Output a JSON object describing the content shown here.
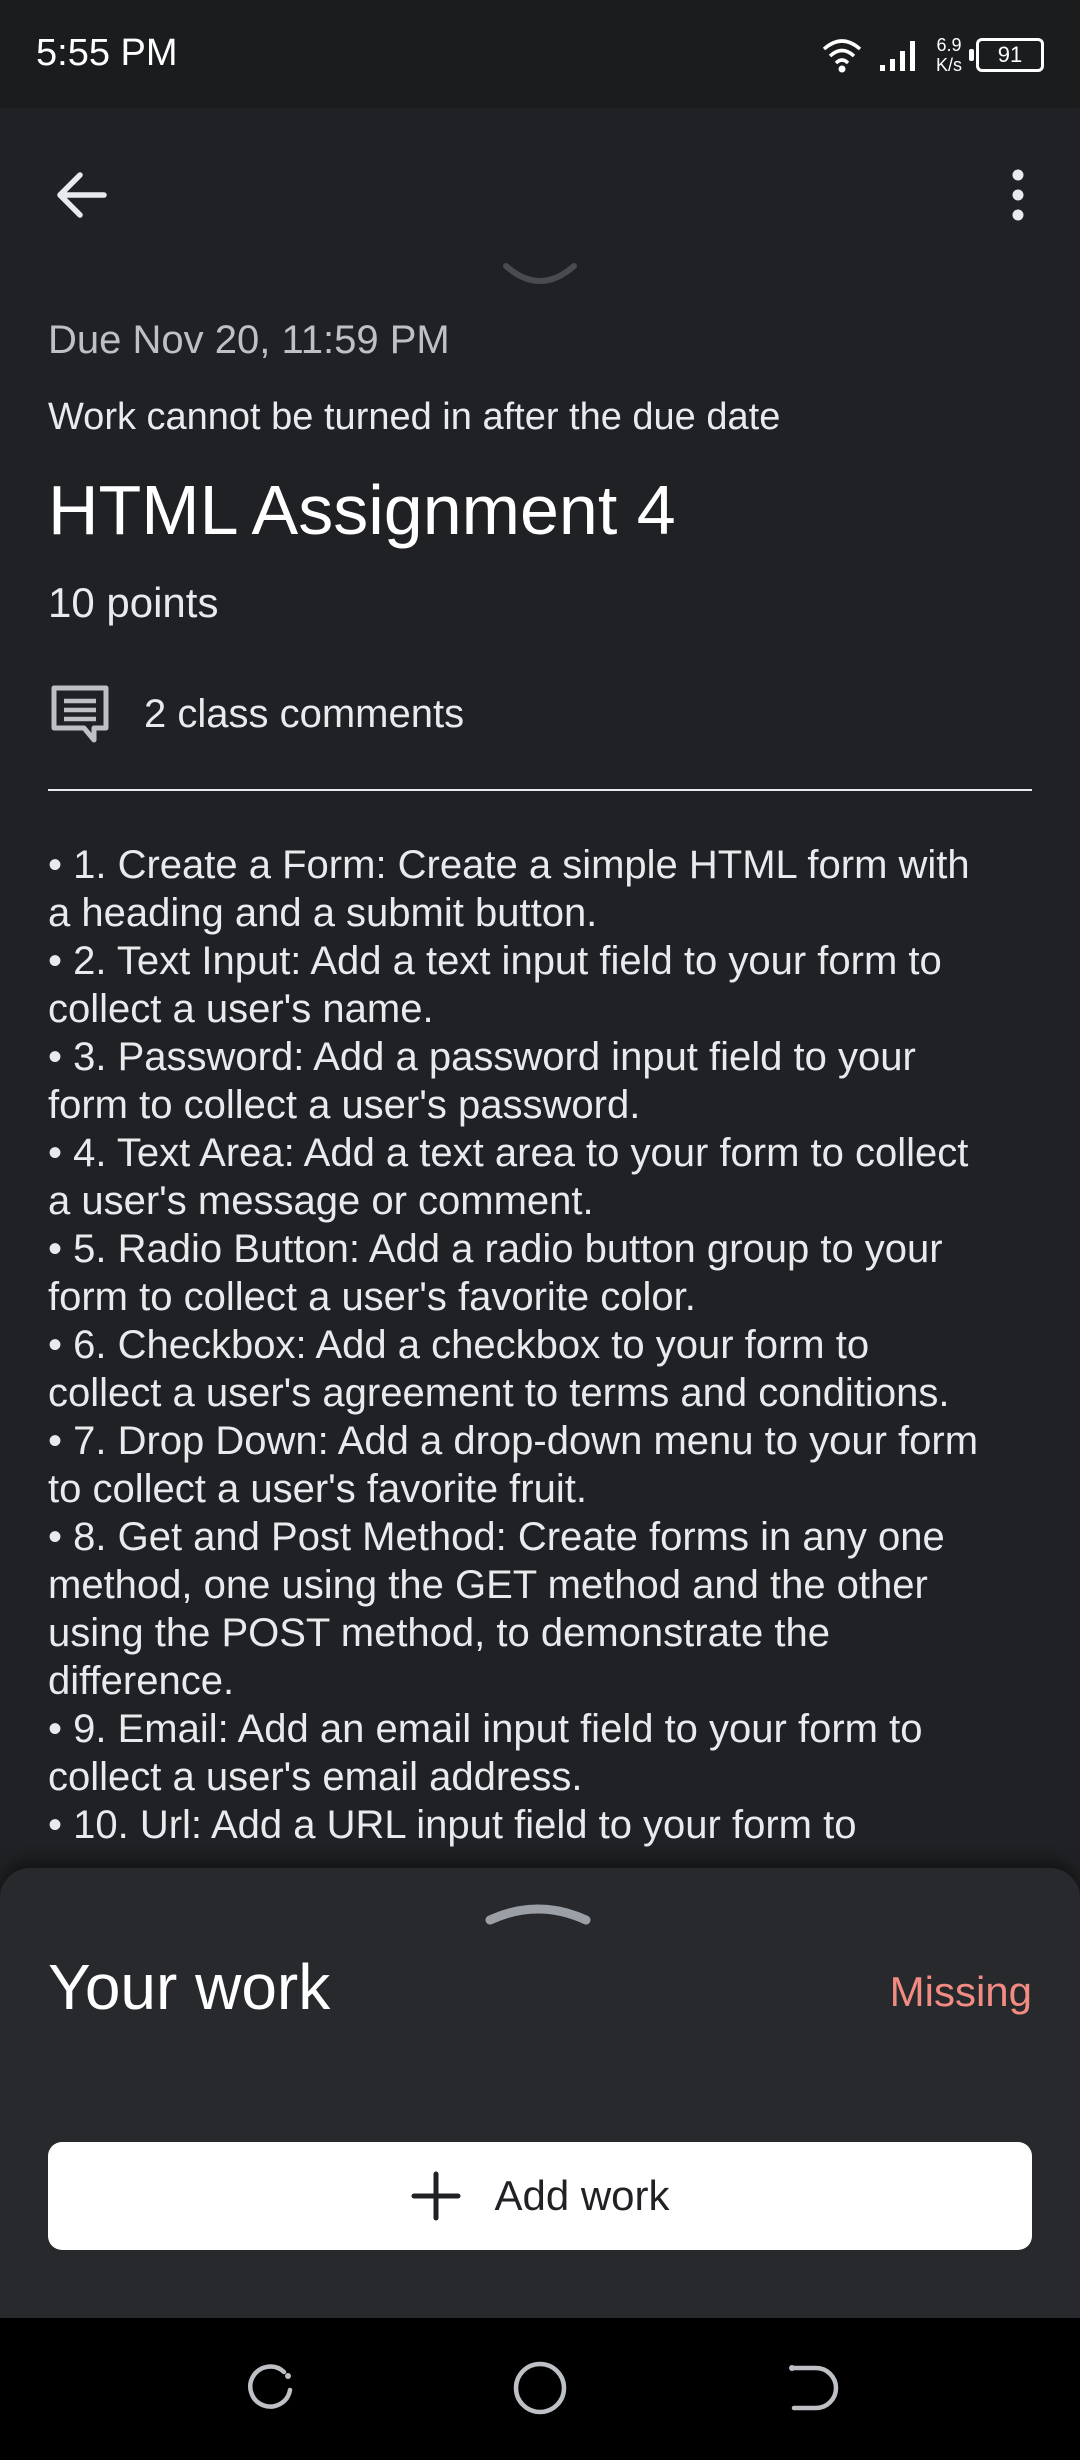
{
  "status_bar": {
    "time": "5:55 PM",
    "net_speed_value": "6.9",
    "net_speed_unit": "K/s",
    "battery": "91"
  },
  "app_bar": {
    "back_icon": "arrow-back-icon",
    "more_icon": "more-vert-icon"
  },
  "assignment": {
    "due": "Due Nov 20, 11:59 PM",
    "late_note": "Work cannot be turned in after the due date",
    "title": "HTML Assignment 4",
    "points": "10 points",
    "comments_label": "2 class comments",
    "comments_icon": "comment-icon"
  },
  "instructions": [
    "• 1. Create a Form: Create a simple HTML form with",
    "a heading and a submit button.",
    "• 2. Text Input: Add a text input field to your form to",
    "collect a user's name.",
    "• 3. Password: Add a password input field to your",
    "form to collect a user's password.",
    "• 4. Text Area: Add a text area to your form to collect",
    "a user's message or comment.",
    "• 5. Radio Button: Add a radio button group to your",
    "form to collect a user's favorite color.",
    "• 6. Checkbox: Add a checkbox to your form to",
    "collect a user's agreement to terms and conditions.",
    "• 7. Drop Down: Add a drop-down menu to your form",
    "to collect a user's favorite fruit.",
    "• 8. Get and Post Method: Create forms in any one",
    "method, one using the GET method and the other",
    "using the POST method, to demonstrate the",
    "difference.",
    "• 9. Email: Add an email input field to your form to",
    "collect a user's email address.",
    "• 10. Url: Add a URL input field to your form to"
  ],
  "your_work": {
    "title": "Your work",
    "status": "Missing",
    "add_label": "Add work",
    "add_icon": "plus-icon"
  },
  "colors": {
    "background": "#202124",
    "sheet": "#28292c",
    "missing": "#f28b82",
    "button": "#ffffff"
  }
}
